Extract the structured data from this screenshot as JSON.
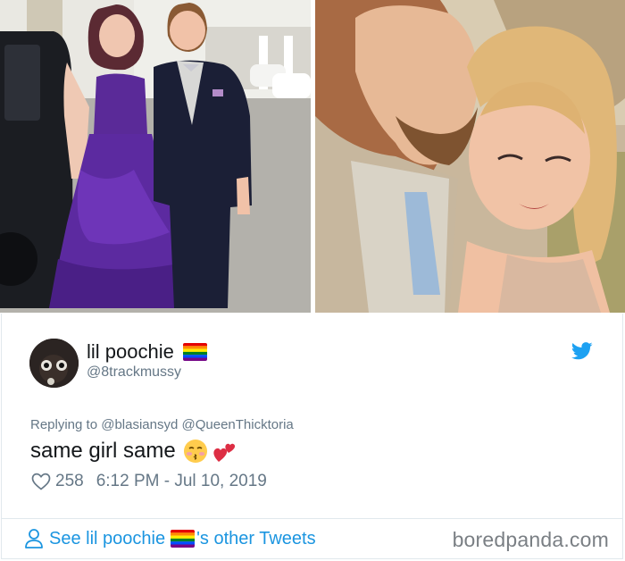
{
  "tweet": {
    "display_name": "lil poochie",
    "handle": "@8trackmussy",
    "reply_prefix": "Replying to",
    "reply_mentions": "@blasiansyd @QueenThicktoria",
    "text": "same girl same",
    "likes": "258",
    "timestamp": "6:12 PM - Jul 10, 2019"
  },
  "footer": {
    "link_prefix": "See lil poochie",
    "link_suffix": "'s other Tweets"
  },
  "watermark": "boredpanda.com",
  "icons": {
    "flag": "rainbow-flag-icon",
    "bird": "twitter-bird-icon",
    "heart": "heart-outline-icon",
    "person": "person-outline-icon",
    "emoji_kiss": "kissing-face-closed-eyes-icon",
    "emoji_hearts": "two-hearts-icon"
  },
  "colors": {
    "link": "#1b95e0",
    "muted": "#657786",
    "text": "#14171a",
    "border": "#e1e8ed"
  }
}
